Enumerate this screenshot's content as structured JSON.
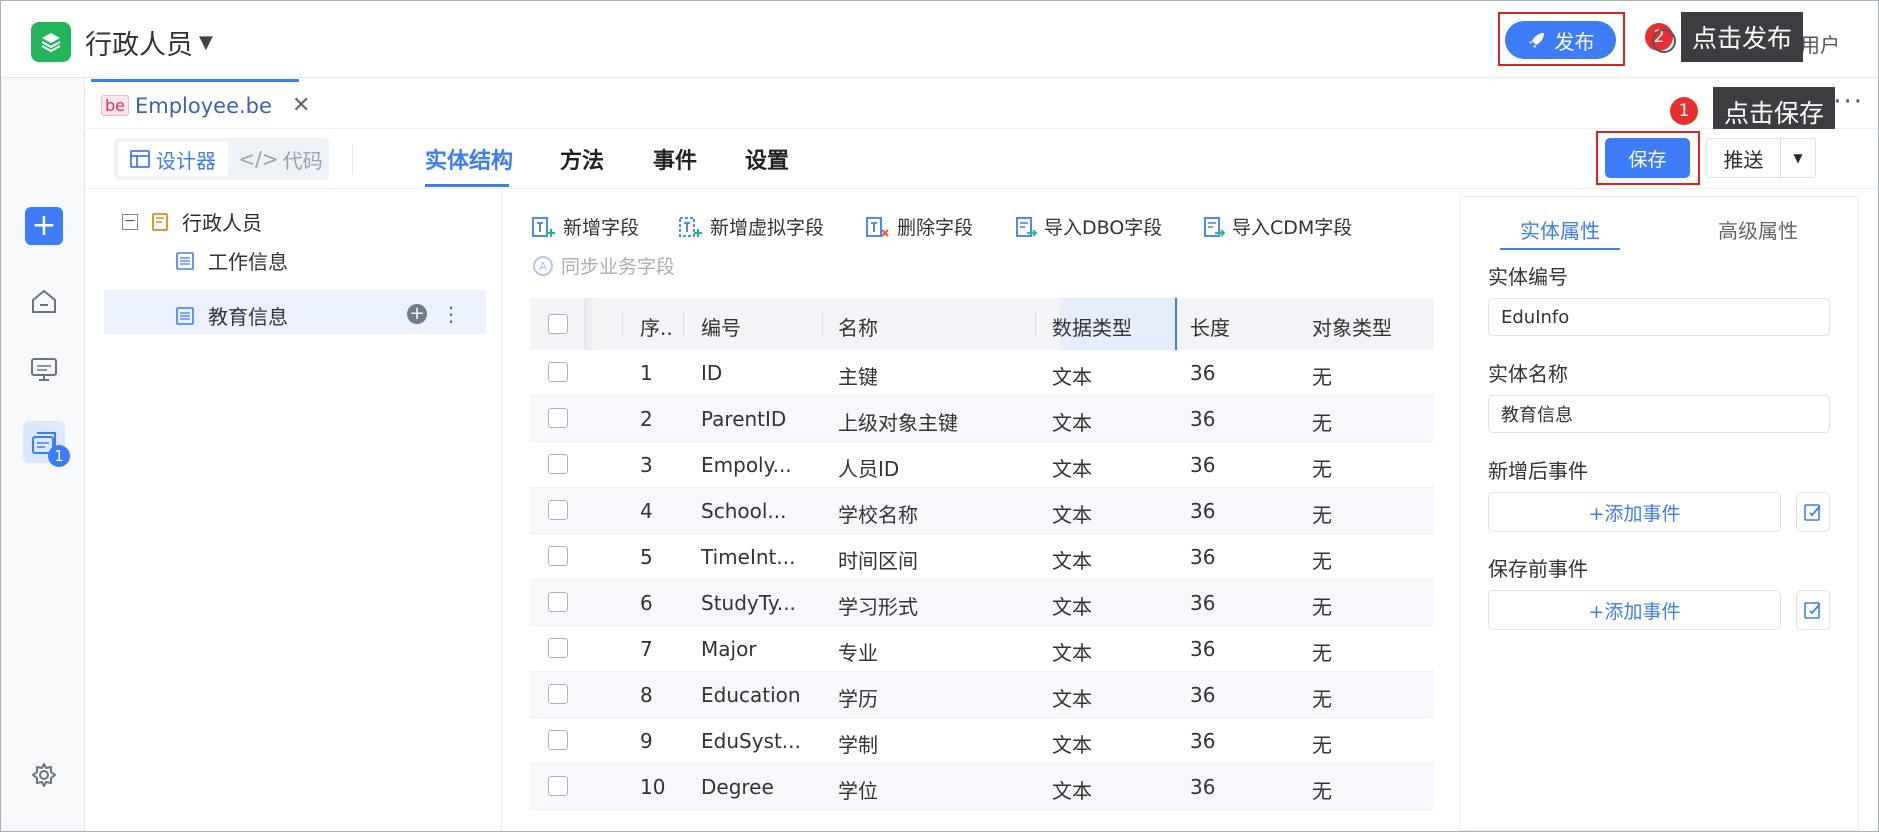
{
  "header": {
    "app_title": "行政人员",
    "publish_label": "发布",
    "publish_step": "2",
    "publish_tip": "点击发布",
    "user_label": "示用户"
  },
  "left_rail": {
    "add_label": "+",
    "badge_count": "1"
  },
  "file_tab": {
    "icon_label": "be",
    "filename": "Employee.be",
    "close_label": "✕",
    "more_label": "···"
  },
  "toolbar": {
    "design_label": "设计器",
    "code_label": "代码",
    "tabs": [
      "实体结构",
      "方法",
      "事件",
      "设置"
    ],
    "save_label": "保存",
    "save_step": "1",
    "save_tip": "点击保存",
    "push_label": "推送"
  },
  "tree": {
    "root": "行政人员",
    "children": [
      "工作信息",
      "教育信息"
    ]
  },
  "field_actions": {
    "add_field": "新增字段",
    "add_virtual_field": "新增虚拟字段",
    "delete_field": "删除字段",
    "import_dbo": "导入DBO字段",
    "import_cdm": "导入CDM字段",
    "sync_business": "同步业务字段"
  },
  "table": {
    "headers": [
      "序..",
      "编号",
      "名称",
      "数据类型",
      "长度",
      "对象类型"
    ],
    "rows": [
      [
        "1",
        "ID",
        "主键",
        "文本",
        "36",
        "无"
      ],
      [
        "2",
        "ParentID",
        "上级对象主键",
        "文本",
        "36",
        "无"
      ],
      [
        "3",
        "Empoly...",
        "人员ID",
        "文本",
        "36",
        "无"
      ],
      [
        "4",
        "School...",
        "学校名称",
        "文本",
        "36",
        "无"
      ],
      [
        "5",
        "TimeInt...",
        "时间区间",
        "文本",
        "36",
        "无"
      ],
      [
        "6",
        "StudyTy...",
        "学习形式",
        "文本",
        "36",
        "无"
      ],
      [
        "7",
        "Major",
        "专业",
        "文本",
        "36",
        "无"
      ],
      [
        "8",
        "Education",
        "学历",
        "文本",
        "36",
        "无"
      ],
      [
        "9",
        "EduSyst...",
        "学制",
        "文本",
        "36",
        "无"
      ],
      [
        "10",
        "Degree",
        "学位",
        "文本",
        "36",
        "无"
      ]
    ]
  },
  "panel": {
    "tab_entity": "实体属性",
    "tab_advanced": "高级属性",
    "code_label": "实体编号",
    "code_value": "EduInfo",
    "name_label": "实体名称",
    "name_value": "教育信息",
    "after_add_label": "新增后事件",
    "before_save_label": "保存前事件",
    "add_event_label": "+添加事件"
  },
  "colors": {
    "primary": "#3d7cf7",
    "brand_green": "#23b55a",
    "highlight_red": "#e02020",
    "tooltip_bg": "#3b3d40"
  }
}
